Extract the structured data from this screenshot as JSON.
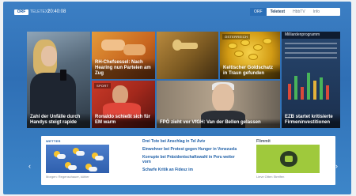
{
  "topbar": {
    "logo": "ORF",
    "brand_sub": "TELETEXT",
    "clock": "20:40:08",
    "tabs": [
      {
        "label": "ORF",
        "active": true
      },
      {
        "label": "Teletext",
        "bold": true
      },
      {
        "label": "HbbTV",
        "bold": false
      },
      {
        "label": "Info",
        "bold": false
      }
    ]
  },
  "tiles": {
    "police": {
      "label": "Zahl der Unfälle durch Handys steigt rapide"
    },
    "hands": {
      "label": "RH-Chefsessel: Nach Hearing nun Parteien am Zug"
    },
    "key": {
      "label": ""
    },
    "gold": {
      "tag": "ÖSTERREICH",
      "label": "Keltischer Goldschatz in Traun gefunden"
    },
    "market": {
      "head": "Milliardenprogramm",
      "label": "EZB startet kritisierte Firmeninvestitionen"
    },
    "soccer": {
      "tag": "SPORT",
      "label": "Ronaldo schießt sich für EM warm"
    },
    "vdb": {
      "label": "FPÖ zieht vor VfGH: Van der Bellen gelassen"
    }
  },
  "panel": {
    "weather": {
      "title": "WETTER",
      "caption": "Morgen: Regenschauer, kühler"
    },
    "news": [
      "Drei Tote bei Anschlag in Tel Aviv",
      "Einwohner bei Protest gegen Hunger in Venezuela",
      "Korrupte bei Präsidentschaftswahl in Peru weiter vorn",
      "Scharfe Kritik an Fidesz im"
    ],
    "flimmit": {
      "title": "Flimmit",
      "caption": "Lieve Otten Streifen"
    }
  },
  "colors": {
    "background": "#3c7fc4",
    "accent": "#1d5ea6",
    "flimmit_green": "#9fc93c"
  }
}
